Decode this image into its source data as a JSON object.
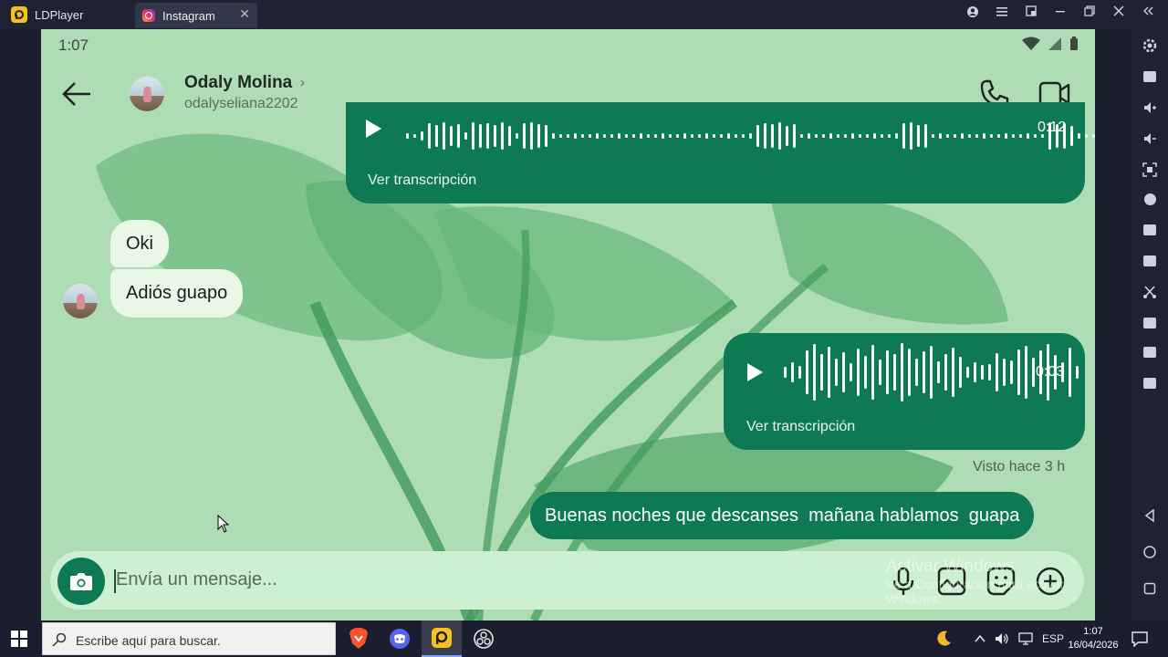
{
  "window": {
    "app_name": "LDPlayer",
    "tab_label": "Instagram",
    "tab_close": "✕"
  },
  "status_bar": {
    "time": "1:07"
  },
  "chat_header": {
    "contact_name": "Odaly Molina",
    "username": "odalyseliana2202"
  },
  "messages": [
    {
      "sender": "me",
      "type": "voice",
      "duration": "0:12",
      "transcription_link": "Ver transcripción"
    },
    {
      "sender": "them",
      "type": "text",
      "text": "Oki"
    },
    {
      "sender": "them",
      "type": "text",
      "text": "Adiós guapo"
    },
    {
      "sender": "me",
      "type": "voice",
      "duration": "0:03",
      "transcription_link": "Ver transcripción"
    },
    {
      "sender": "me",
      "type": "text",
      "text": "Buenas noches que descanses  mañana hablamos  guapa"
    }
  ],
  "seen_status": "Visto hace 3 h",
  "composer": {
    "placeholder": "Envía un mensaje..."
  },
  "watermark": {
    "line1": "Activar Windows",
    "line2": "Ve a Configuración para activar Windows."
  },
  "taskbar": {
    "search_placeholder": "Escribe aquí para buscar.",
    "language": "ESP",
    "clock_time": "1:07",
    "clock_date": "16/04/2026"
  },
  "colors": {
    "chat_background": "#aedcb5",
    "outgoing_bubble": "#0d7a54",
    "incoming_bubble": "#e9f7e9",
    "composer_background": "#cdf0d2"
  }
}
